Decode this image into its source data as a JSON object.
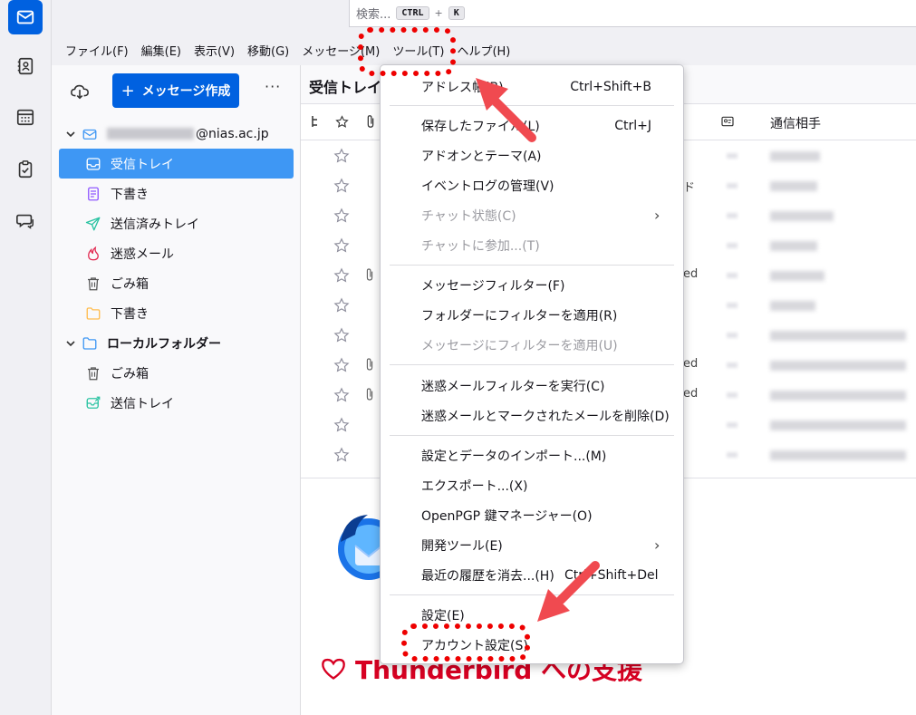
{
  "search": {
    "placeholder": "検索...",
    "key1": "CTRL",
    "plus": "+",
    "key2": "K"
  },
  "menubar": {
    "file": "ファイル(F)",
    "edit": "編集(E)",
    "view": "表示(V)",
    "go": "移動(G)",
    "message": "メッセージ(M)",
    "tools": "ツール(T)",
    "help": "ヘルプ(H)"
  },
  "folder_pane": {
    "compose_label": "メッセージ作成",
    "more": "···",
    "account_suffix": "@nias.ac.jp",
    "folders": [
      {
        "label": "受信トレイ"
      },
      {
        "label": "下書き"
      },
      {
        "label": "送信済みトレイ"
      },
      {
        "label": "迷惑メール"
      },
      {
        "label": "ごみ箱"
      },
      {
        "label": "下書き"
      }
    ],
    "local_label": "ローカルフォルダー",
    "local_folders": [
      {
        "label": "ごみ箱"
      },
      {
        "label": "送信トレイ"
      }
    ]
  },
  "thread_pane": {
    "title": "受信トレイ",
    "correspondent_header": "通信相手",
    "row_tails": [
      "",
      "ド",
      "",
      "",
      "ed",
      "",
      "",
      "ed",
      "ed",
      "",
      ""
    ]
  },
  "message_pane": {
    "support_heading": "Thunderbird への支援"
  },
  "tools_menu": {
    "address_book": "アドレス帳(B)",
    "address_book_shortcut": "Ctrl+Shift+B",
    "saved_files": "保存したファイル(L)",
    "saved_files_shortcut": "Ctrl+J",
    "addons": "アドオンとテーマ(A)",
    "activity": "イベントログの管理(V)",
    "chat_status": "チャット状態(C)",
    "join_chat": "チャットに参加...(T)",
    "message_filters": "メッセージフィルター(F)",
    "apply_filters_folder": "フォルダーにフィルターを適用(R)",
    "apply_filters_message": "メッセージにフィルターを適用(U)",
    "run_junk_controls": "迷惑メールフィルターを実行(C)",
    "delete_junk": "迷惑メールとマークされたメールを削除(D)",
    "import": "設定とデータのインポート...(M)",
    "export": "エクスポート...(X)",
    "openpgp": "OpenPGP 鍵マネージャー(O)",
    "dev_tools": "開発ツール(E)",
    "clear_history": "最近の履歴を消去...(H)",
    "clear_history_shortcut": "Ctrl+Shift+Del",
    "settings": "設定(E)",
    "account_settings": "アカウント設定(S)",
    "submenu_arrow": "›"
  },
  "colors": {
    "accent": "#0061e0",
    "selected": "#3e97f4",
    "annotation": "#ee0000",
    "support": "#d70022"
  }
}
